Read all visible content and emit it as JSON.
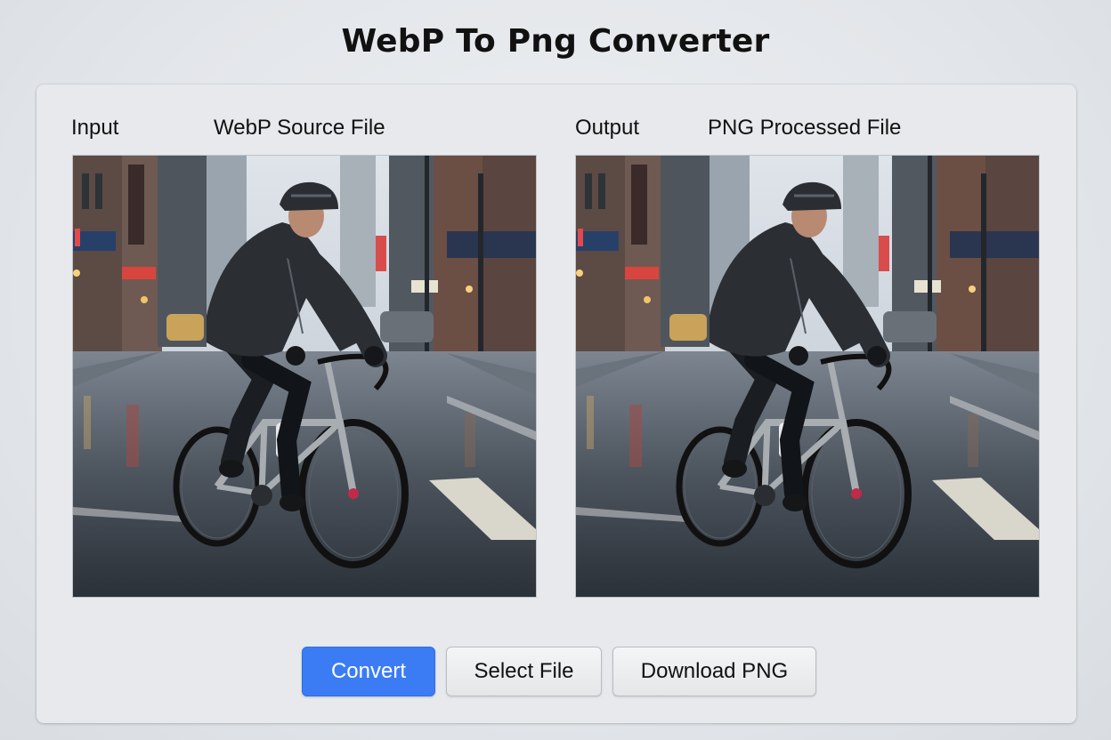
{
  "header": {
    "title": "WebP To Png Converter"
  },
  "input": {
    "label": "Input",
    "description": "WebP Source File",
    "image_alt": "Cyclist riding a road bike on a wet city street in the rain"
  },
  "output": {
    "label": "Output",
    "description": "PNG Processed File",
    "image_alt": "Cyclist riding a road bike on a wet city street in the rain"
  },
  "actions": {
    "convert_label": "Convert",
    "select_label": "Select File",
    "download_label": "Download PNG"
  },
  "colors": {
    "primary": "#3b7cf5",
    "panel": "#e7e9ec",
    "background": "#e3e6ea"
  }
}
